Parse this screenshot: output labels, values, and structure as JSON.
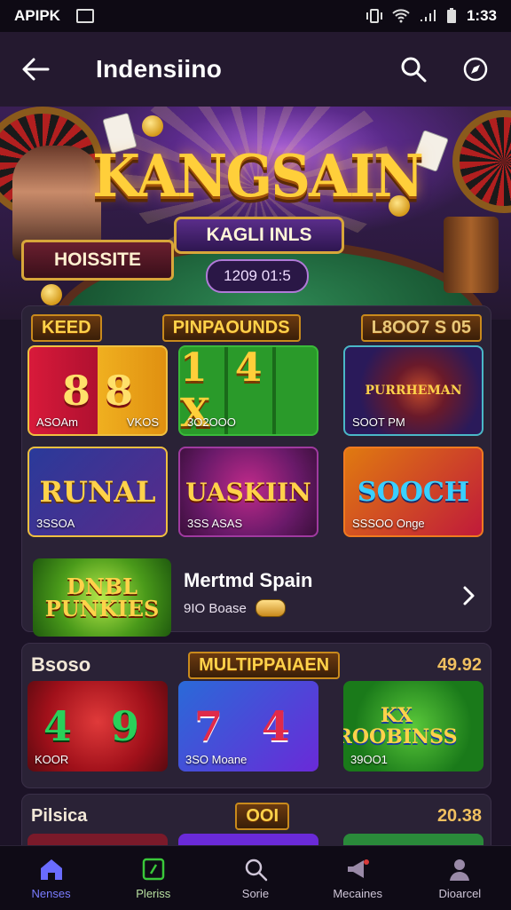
{
  "status": {
    "carrier": "APIPK",
    "time": "1:33"
  },
  "app": {
    "title": "Indensiino"
  },
  "hero": {
    "brand": "KANGSAIN",
    "ribbon": "KAGLI INLS",
    "badge": "HOISSITE",
    "pill": "1209 01:5"
  },
  "section1": {
    "left_label": "KEED",
    "center_label": "PINPAOUNDS",
    "right_label": "L8OO7 S 05",
    "tiles": [
      {
        "art": "8 8",
        "cap": "ASOAm",
        "cap_right": "VKOS"
      },
      {
        "art": "1 4 X",
        "cap": "3O2OOO"
      },
      {
        "art": "PURRHEMAN",
        "cap": "SOOT PM"
      },
      {
        "art": "RUNAL",
        "cap": "3SSOA"
      },
      {
        "art": "UASKIIN",
        "cap": "3SS ASAS"
      },
      {
        "art": "SOOCH",
        "cap": "SSSOO Onge"
      }
    ],
    "feature": {
      "thumb_text": "DNBL PUNKIES",
      "name": "Mertmd Spain",
      "sub": "9IO Boase"
    }
  },
  "section2": {
    "left_label": "Bsoso",
    "center_label": "MULTIPPAIAEN",
    "right_label": "49.92",
    "tiles": [
      {
        "art": "4 9",
        "cap": "KOOR"
      },
      {
        "art": "7 4",
        "cap": "3SO Moane"
      },
      {
        "art": "KX ROOBINSS",
        "cap": "39OO1"
      }
    ]
  },
  "section3": {
    "left_label": "Pilsica",
    "center_label": "OOI",
    "right_label": "20.38"
  },
  "nav": {
    "items": [
      {
        "label": "Nenses",
        "icon": "home-icon"
      },
      {
        "label": "Pleriss",
        "icon": "dice-icon"
      },
      {
        "label": "Sorie",
        "icon": "search-icon"
      },
      {
        "label": "Mecaines",
        "icon": "megaphone-icon"
      },
      {
        "label": "Dioarcel",
        "icon": "profile-icon"
      }
    ],
    "active_index": 0
  },
  "colors": {
    "accent": "#7a7cff",
    "gold": "#ffd24a",
    "background": "#1c1327"
  }
}
